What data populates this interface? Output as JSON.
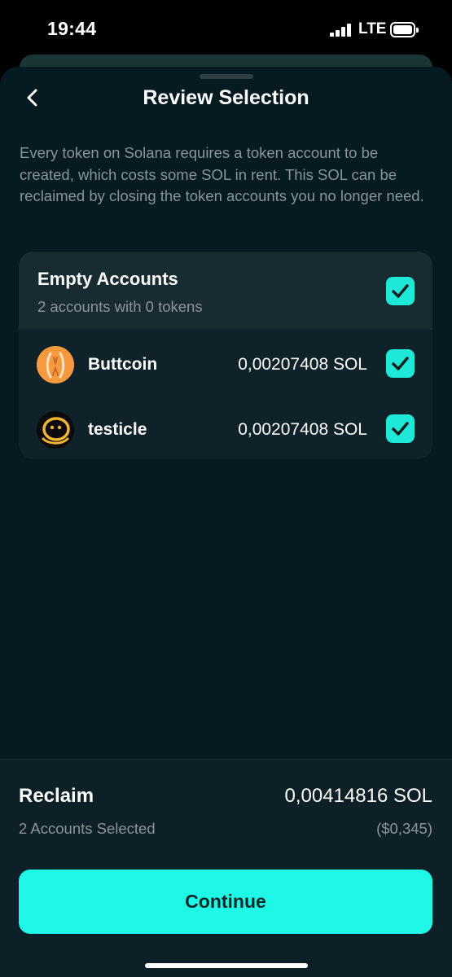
{
  "status_bar": {
    "time": "19:44",
    "network": "LTE"
  },
  "sheet": {
    "title": "Review Selection",
    "back_icon": "chevron-left-icon",
    "description": "Every token on Solana requires a token account to be created, which costs some SOL in rent. This SOL can be reclaimed by closing the token accounts you no longer need."
  },
  "accounts_card": {
    "title": "Empty Accounts",
    "subtitle": "2 accounts with 0 tokens",
    "all_checked": true,
    "tokens": [
      {
        "name": "Buttcoin",
        "amount": "0,00207408 SOL",
        "checked": true,
        "icon": "buttcoin-logo-icon"
      },
      {
        "name": "testicle",
        "amount": "0,00207408 SOL",
        "checked": true,
        "icon": "testicle-logo-icon"
      }
    ]
  },
  "footer": {
    "reclaim_label": "Reclaim",
    "reclaim_amount": "0,00414816 SOL",
    "selected_count": "2 Accounts Selected",
    "fiat_amount": "($0,345)",
    "continue_label": "Continue"
  },
  "colors": {
    "background": "#061a22",
    "accent": "#1ff8e6",
    "checkbox": "#1ee9d9",
    "muted_text": "#8a959b"
  }
}
